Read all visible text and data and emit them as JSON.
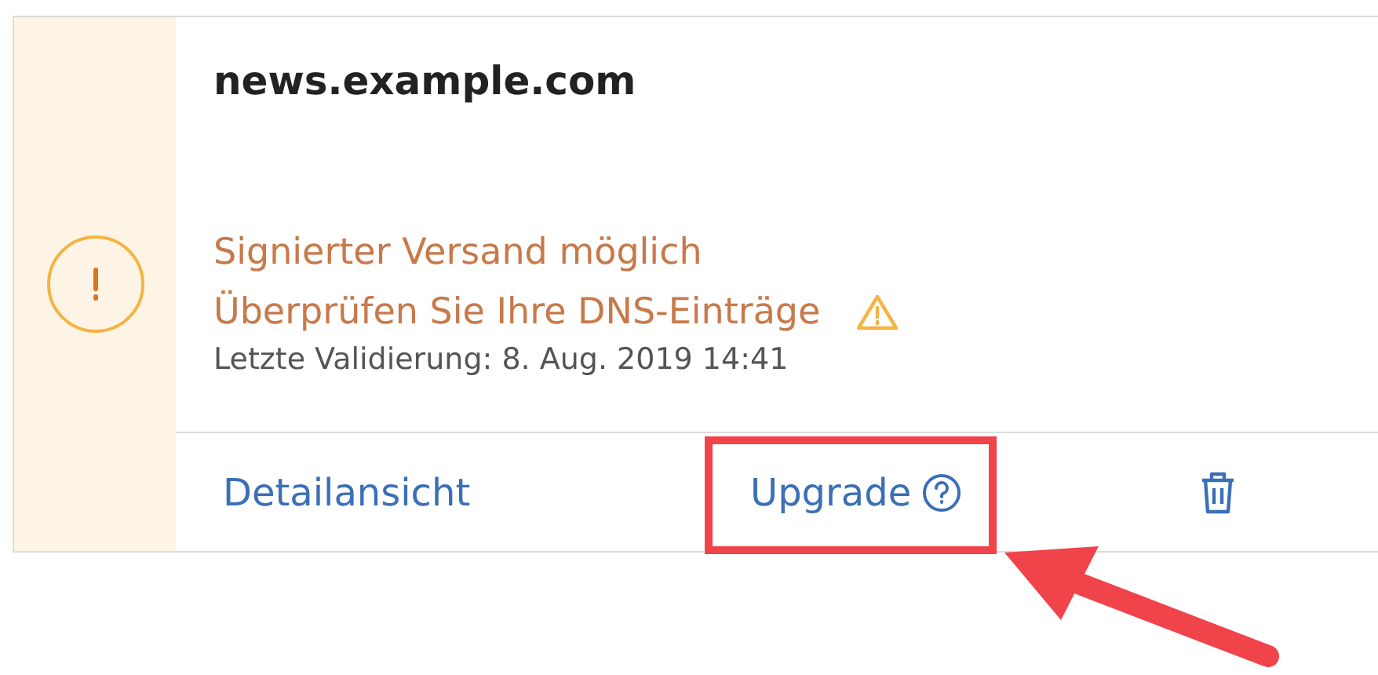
{
  "domain": {
    "title": "news.example.com",
    "status_lines": [
      "Signierter Versand möglich",
      "Überprüfen Sie Ihre DNS-Einträge"
    ],
    "last_validation": "Letzte Validierung: 8. Aug. 2019 14:41"
  },
  "actions": {
    "details": "Detailansicht",
    "upgrade": "Upgrade"
  }
}
